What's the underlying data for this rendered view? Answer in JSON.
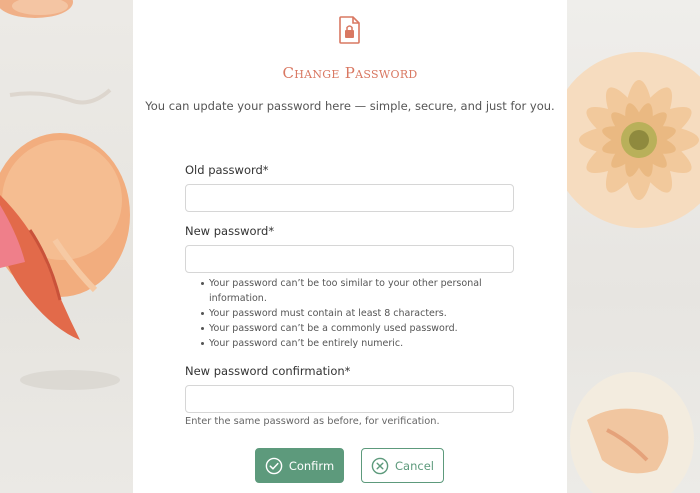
{
  "page": {
    "title": "Change Password",
    "subtitle": "You can update your password here — simple, secure, and just for you."
  },
  "form": {
    "old_password": {
      "label": "Old password*",
      "value": ""
    },
    "new_password": {
      "label": "New password*",
      "value": ""
    },
    "password_rules": [
      "Your password can’t be too similar to your other personal information.",
      "Your password must contain at least 8 characters.",
      "Your password can’t be a commonly used password.",
      "Your password can’t be entirely numeric."
    ],
    "confirm_password": {
      "label": "New password confirmation*",
      "value": "",
      "help": "Enter the same password as before, for verification."
    }
  },
  "actions": {
    "confirm_label": "Confirm",
    "cancel_label": "Cancel"
  },
  "colors": {
    "accent": "#d97862",
    "primary": "#5d9a7c"
  },
  "icons": [
    "lock-file-icon",
    "check-circle-icon",
    "x-circle-icon"
  ]
}
